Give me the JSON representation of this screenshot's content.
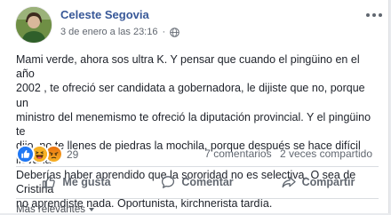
{
  "post": {
    "author": "Celeste Segovia",
    "date": "3 de enero a las 23:16",
    "separator": "·",
    "privacy_icon": "globe-icon",
    "text": "Mami verde, ahora sos ultra K. Y pensar que cuando el pingüino en el año\n2002 , te ofreció ser candidata a gobernadora, le dijiste que no, porque un\nministro del menemismo te ofreció la diputación provincial. Y el pingüino te\ndijo, no te llenes de piedras la mochila, porque después se hace difícil llevarla.\nDeberías haber aprendido que la sororidad no es selectiva. O sea de Cristina\nno aprendiste nada. Oportunista, kirchnerista tardía."
  },
  "stats": {
    "reactions": [
      "like-icon",
      "haha-icon",
      "angry-icon"
    ],
    "reaction_count": "29",
    "comments": "7 comentarios",
    "shares": "2 veces compartido"
  },
  "actions": {
    "like": "Me gusta",
    "comment": "Comentar",
    "share": "Compartir"
  },
  "comments": {
    "sort_label": "Más relevantes"
  },
  "colors": {
    "author": "#385898",
    "like": "#2078f4",
    "haha": "#f7b125",
    "angry": "#e9710f"
  }
}
